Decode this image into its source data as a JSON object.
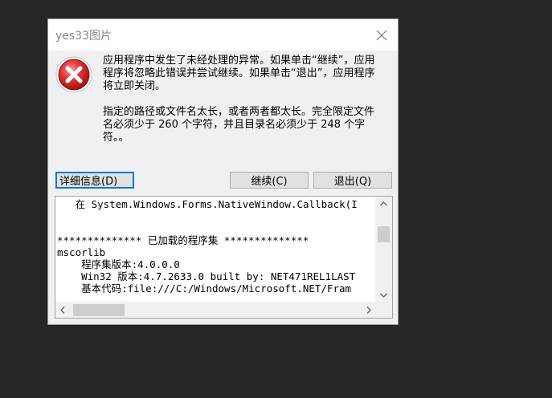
{
  "window": {
    "title": "yes33图片",
    "icon": "error-icon",
    "close_icon": "close-icon"
  },
  "message": {
    "line1": "应用程序中发生了未经处理的异常。如果单击“继续”，应用程序将忽略此错误并尝试继续。如果单击“退出”，应用程序将立即关闭。",
    "line2": "指定的路径或文件名太长，或者两者都太长。完全限定文件名必须少于 260 个字符，并且目录名必须少于 248 个字符。。"
  },
  "buttons": {
    "details": "详细信息(D)",
    "continue": "继续(C)",
    "quit": "退出(Q)"
  },
  "details": {
    "lines": [
      "   在 System.Windows.Forms.NativeWindow.Callback(I",
      "",
      "",
      "************** 已加载的程序集 **************",
      "mscorlib",
      "    程序集版本:4.0.0.0",
      "    Win32 版本:4.7.2633.0 built by: NET471REL1LAST",
      "    基本代码:file:///C:/Windows/Microsoft.NET/Fram"
    ]
  },
  "colors": {
    "error_red": "#d32f2f",
    "focus_border": "#0078d7",
    "desktop": "#262626"
  }
}
